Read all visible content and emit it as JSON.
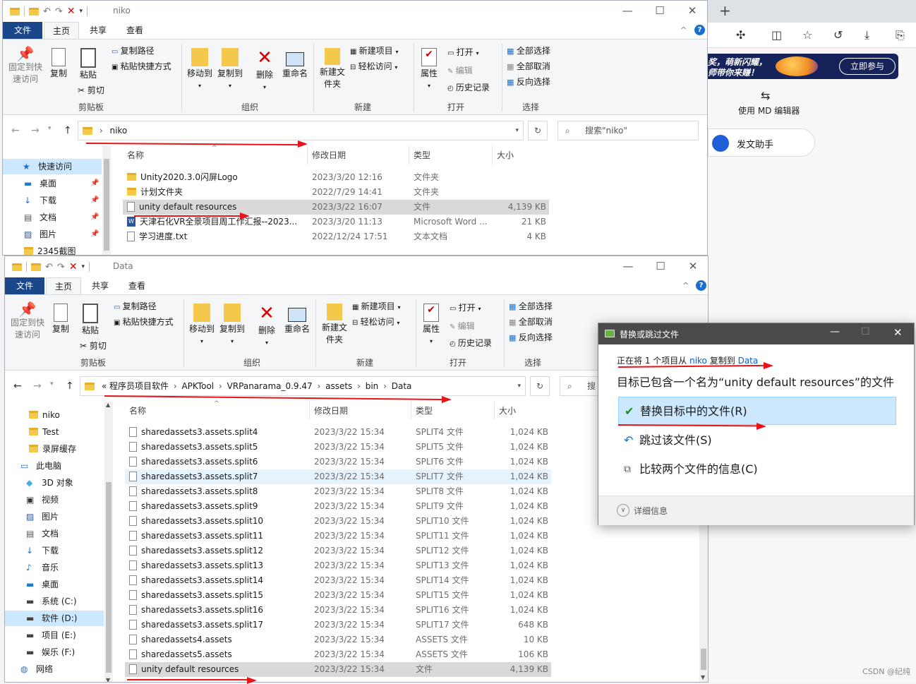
{
  "window1": {
    "title": "niko",
    "menu": {
      "file": "文件",
      "home": "主页",
      "share": "共享",
      "view": "查看"
    },
    "ribbon": {
      "pin": "固定到快速访问",
      "copy": "复制",
      "paste": "粘贴",
      "copy_path": "复制路径",
      "paste_shortcut": "粘贴快捷方式",
      "cut": "剪切",
      "move_to": "移动到",
      "copy_to": "复制到",
      "delete": "删除",
      "rename": "重命名",
      "new_folder": "新建文件夹",
      "new_item": "新建项目",
      "easy_access": "轻松访问",
      "properties": "属性",
      "open": "打开",
      "edit": "编辑",
      "history": "历史记录",
      "select_all": "全部选择",
      "select_none": "全部取消",
      "invert": "反向选择",
      "g_clipboard": "剪贴板",
      "g_organize": "组织",
      "g_new": "新建",
      "g_open": "打开",
      "g_select": "选择"
    },
    "address": "niko",
    "search_placeholder": "搜索\"niko\"",
    "columns": {
      "name": "名称",
      "date": "修改日期",
      "type": "类型",
      "size": "大小"
    },
    "nav": [
      {
        "label": "快速访问",
        "icon": "star-icon"
      },
      {
        "label": "桌面",
        "icon": "desktop-icon"
      },
      {
        "label": "下载",
        "icon": "download-icon"
      },
      {
        "label": "文档",
        "icon": "document-icon"
      },
      {
        "label": "图片",
        "icon": "picture-icon"
      },
      {
        "label": "2345截图",
        "icon": "folder-icon"
      }
    ],
    "files": [
      {
        "name": "Unity2020.3.0闪屏Logo",
        "date": "2023/3/20 12:16",
        "type": "文件夹",
        "size": "",
        "icon": "folder"
      },
      {
        "name": "计划文件夹",
        "date": "2022/7/29 14:41",
        "type": "文件夹",
        "size": "",
        "icon": "folder"
      },
      {
        "name": "unity default resources",
        "date": "2023/3/22 16:07",
        "type": "文件",
        "size": "4,139 KB",
        "icon": "doc"
      },
      {
        "name": "天津石化VR全景项目周工作汇报--2023...",
        "date": "2023/3/20 11:13",
        "type": "Microsoft Word ...",
        "size": "21 KB",
        "icon": "word"
      },
      {
        "name": "学习进度.txt",
        "date": "2022/12/24 17:51",
        "type": "文本文档",
        "size": "4 KB",
        "icon": "doc"
      }
    ]
  },
  "window2": {
    "title": "Data",
    "breadcrumb": [
      "«",
      "程序员项目软件",
      "APKTool",
      "VRPanarama_0.9.47",
      "assets",
      "bin",
      "Data"
    ],
    "search_placeholder": "搜",
    "nav": [
      {
        "label": "niko",
        "icon": "folder-icon"
      },
      {
        "label": "Test",
        "icon": "folder-icon"
      },
      {
        "label": "录屏缓存",
        "icon": "folder-icon"
      },
      {
        "label": "此电脑",
        "icon": "pc-icon"
      },
      {
        "label": "3D 对象",
        "icon": "cube-icon"
      },
      {
        "label": "视频",
        "icon": "video-icon"
      },
      {
        "label": "图片",
        "icon": "picture-icon"
      },
      {
        "label": "文档",
        "icon": "document-icon"
      },
      {
        "label": "下载",
        "icon": "download-icon"
      },
      {
        "label": "音乐",
        "icon": "music-icon"
      },
      {
        "label": "桌面",
        "icon": "desktop-icon"
      },
      {
        "label": "系统 (C:)",
        "icon": "drive-icon"
      },
      {
        "label": "软件 (D:)",
        "icon": "drive-icon"
      },
      {
        "label": "项目 (E:)",
        "icon": "drive-icon"
      },
      {
        "label": "娱乐 (F:)",
        "icon": "drive-icon"
      },
      {
        "label": "网络",
        "icon": "network-icon"
      }
    ],
    "files": [
      {
        "name": "sharedassets3.assets.split4",
        "date": "2023/3/22 15:34",
        "type": "SPLIT4 文件",
        "size": "1,024 KB"
      },
      {
        "name": "sharedassets3.assets.split5",
        "date": "2023/3/22 15:34",
        "type": "SPLIT5 文件",
        "size": "1,024 KB"
      },
      {
        "name": "sharedassets3.assets.split6",
        "date": "2023/3/22 15:34",
        "type": "SPLIT6 文件",
        "size": "1,024 KB"
      },
      {
        "name": "sharedassets3.assets.split7",
        "date": "2023/3/22 15:34",
        "type": "SPLIT7 文件",
        "size": "1,024 KB"
      },
      {
        "name": "sharedassets3.assets.split8",
        "date": "2023/3/22 15:34",
        "type": "SPLIT8 文件",
        "size": "1,024 KB"
      },
      {
        "name": "sharedassets3.assets.split9",
        "date": "2023/3/22 15:34",
        "type": "SPLIT9 文件",
        "size": "1,024 KB"
      },
      {
        "name": "sharedassets3.assets.split10",
        "date": "2023/3/22 15:34",
        "type": "SPLIT10 文件",
        "size": "1,024 KB"
      },
      {
        "name": "sharedassets3.assets.split11",
        "date": "2023/3/22 15:34",
        "type": "SPLIT11 文件",
        "size": "1,024 KB"
      },
      {
        "name": "sharedassets3.assets.split12",
        "date": "2023/3/22 15:34",
        "type": "SPLIT12 文件",
        "size": "1,024 KB"
      },
      {
        "name": "sharedassets3.assets.split13",
        "date": "2023/3/22 15:34",
        "type": "SPLIT13 文件",
        "size": "1,024 KB"
      },
      {
        "name": "sharedassets3.assets.split14",
        "date": "2023/3/22 15:34",
        "type": "SPLIT14 文件",
        "size": "1,024 KB"
      },
      {
        "name": "sharedassets3.assets.split15",
        "date": "2023/3/22 15:34",
        "type": "SPLIT15 文件",
        "size": "1,024 KB"
      },
      {
        "name": "sharedassets3.assets.split16",
        "date": "2023/3/22 15:34",
        "type": "SPLIT16 文件",
        "size": "1,024 KB"
      },
      {
        "name": "sharedassets3.assets.split17",
        "date": "2023/3/22 15:34",
        "type": "SPLIT17 文件",
        "size": "648 KB"
      },
      {
        "name": "sharedassets4.assets",
        "date": "2023/3/22 15:34",
        "type": "ASSETS 文件",
        "size": "10 KB"
      },
      {
        "name": "sharedassets5.assets",
        "date": "2023/3/22 15:34",
        "type": "ASSETS 文件",
        "size": "106 KB"
      },
      {
        "name": "unity default resources",
        "date": "2023/3/22 15:34",
        "type": "文件",
        "size": "4,139 KB"
      }
    ]
  },
  "dialog": {
    "title": "替换或跳过文件",
    "line1_prefix": "正在将 1 个项目从",
    "line1_src": "niko",
    "line1_mid": "复制到",
    "line1_dst": "Data",
    "line2": "目标已包含一个名为“unity default resources”的文件",
    "opt_replace": "替换目标中的文件(R)",
    "opt_skip": "跳过该文件(S)",
    "opt_compare": "比较两个文件的信息(C)",
    "details": "详细信息"
  },
  "browser": {
    "banner_text1": "奖，萌新闪耀，",
    "banner_text2": "师带你来赚！",
    "banner_btn": "立即参与",
    "md_editor": "使用 MD 编辑器",
    "assistant": "发文助手"
  },
  "watermark": "CSDN @纪纯",
  "colors": {
    "accent": "#19478a",
    "select": "#cce8ff",
    "red": "#e8131b"
  }
}
